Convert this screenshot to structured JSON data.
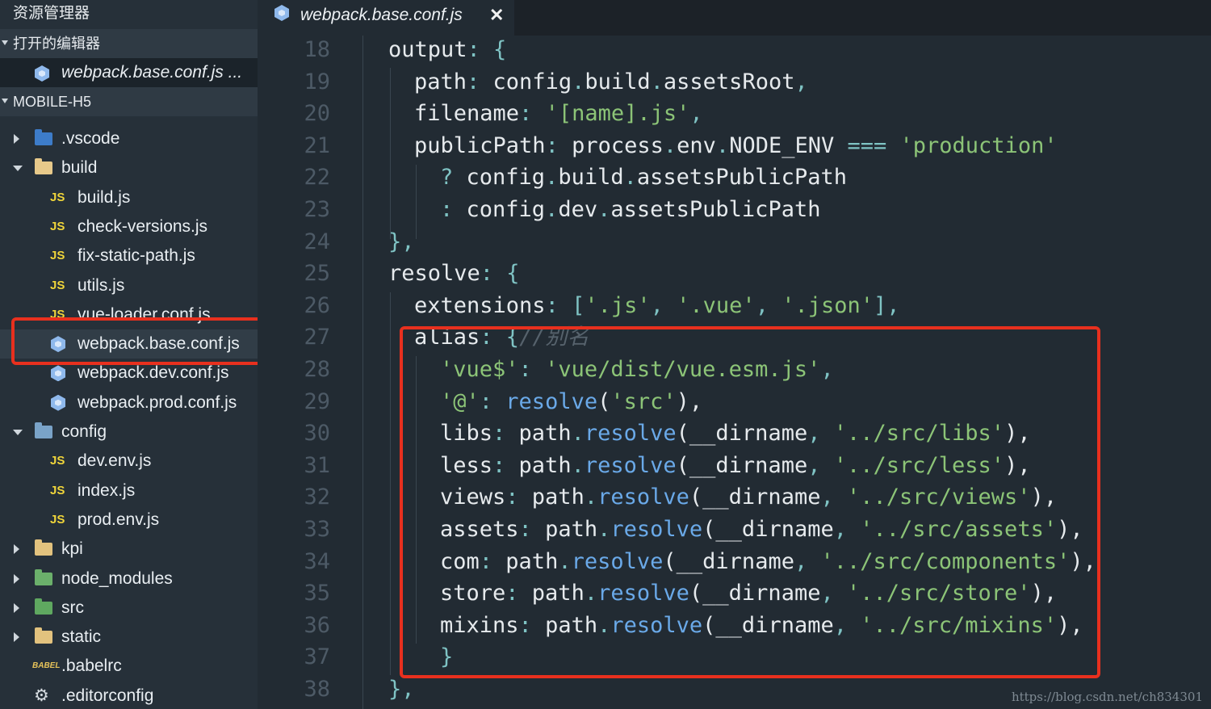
{
  "explorer": {
    "title": "资源管理器",
    "open_editors_header": "打开的编辑器",
    "open_editors": [
      {
        "name": "webpack.base.conf.js ...",
        "icon": "webpack-icon"
      }
    ],
    "project_header": "MOBILE-H5",
    "tree": [
      {
        "label": ".vscode",
        "icon": "vscode-folder-icon",
        "arrow": "collapsed",
        "depth": 0
      },
      {
        "label": "build",
        "icon": "folder-icon",
        "arrow": "expanded",
        "depth": 0
      },
      {
        "label": "build.js",
        "icon": "js-icon",
        "depth": 1
      },
      {
        "label": "check-versions.js",
        "icon": "js-icon",
        "depth": 1
      },
      {
        "label": "fix-static-path.js",
        "icon": "js-icon",
        "depth": 1
      },
      {
        "label": "utils.js",
        "icon": "js-icon",
        "depth": 1
      },
      {
        "label": "vue-loader.conf.js",
        "icon": "js-icon",
        "depth": 1
      },
      {
        "label": "webpack.base.conf.js",
        "icon": "webpack-icon",
        "depth": 1,
        "selected": true
      },
      {
        "label": "webpack.dev.conf.js",
        "icon": "webpack-icon",
        "depth": 1
      },
      {
        "label": "webpack.prod.conf.js",
        "icon": "webpack-icon",
        "depth": 1
      },
      {
        "label": "config",
        "icon": "config-folder-icon",
        "arrow": "expanded",
        "depth": 0
      },
      {
        "label": "dev.env.js",
        "icon": "js-icon",
        "depth": 1
      },
      {
        "label": "index.js",
        "icon": "js-icon",
        "depth": 1
      },
      {
        "label": "prod.env.js",
        "icon": "js-icon",
        "depth": 1
      },
      {
        "label": "kpi",
        "icon": "folder-icon",
        "arrow": "collapsed",
        "depth": 0
      },
      {
        "label": "node_modules",
        "icon": "node-folder-icon",
        "arrow": "collapsed",
        "depth": 0
      },
      {
        "label": "src",
        "icon": "src-folder-icon",
        "arrow": "collapsed",
        "depth": 0
      },
      {
        "label": "static",
        "icon": "folder-icon",
        "arrow": "collapsed",
        "depth": 0
      },
      {
        "label": ".babelrc",
        "icon": "babel-icon",
        "depth": 0
      },
      {
        "label": ".editorconfig",
        "icon": "editorconfig-icon",
        "depth": 0
      }
    ],
    "js_badge": "JS",
    "babel_badge": "BABEL"
  },
  "tab": {
    "label": "webpack.base.conf.js",
    "close": "✕"
  },
  "editor": {
    "lines": [
      {
        "num": "18",
        "indent": 0,
        "tokens": [
          [
            "output",
            "#e6eaed"
          ],
          [
            ": {",
            "#7fc3c4"
          ]
        ]
      },
      {
        "num": "19",
        "indent": 1,
        "tokens": [
          [
            "path",
            "#e6eaed"
          ],
          [
            ": ",
            "#7fc3c4"
          ],
          [
            "config",
            "#e6eaed"
          ],
          [
            ".",
            "#7fc3c4"
          ],
          [
            "build",
            "#e6eaed"
          ],
          [
            ".",
            "#7fc3c4"
          ],
          [
            "assetsRoot",
            "#e6eaed"
          ],
          [
            ",",
            "#7fc3c4"
          ]
        ]
      },
      {
        "num": "20",
        "indent": 1,
        "tokens": [
          [
            "filename",
            "#e6eaed"
          ],
          [
            ": ",
            "#7fc3c4"
          ],
          [
            "'[name].js'",
            "#8cc477"
          ],
          [
            ",",
            "#7fc3c4"
          ]
        ]
      },
      {
        "num": "21",
        "indent": 1,
        "tokens": [
          [
            "publicPath",
            "#e6eaed"
          ],
          [
            ": ",
            "#7fc3c4"
          ],
          [
            "process",
            "#e6eaed"
          ],
          [
            ".",
            "#7fc3c4"
          ],
          [
            "env",
            "#e6eaed"
          ],
          [
            ".",
            "#7fc3c4"
          ],
          [
            "NODE_ENV",
            "#e6eaed"
          ],
          [
            " === ",
            "#7fc3c4"
          ],
          [
            "'production'",
            "#8cc477"
          ]
        ]
      },
      {
        "num": "22",
        "indent": 2,
        "tokens": [
          [
            "? ",
            "#7fc3c4"
          ],
          [
            "config",
            "#e6eaed"
          ],
          [
            ".",
            "#7fc3c4"
          ],
          [
            "build",
            "#e6eaed"
          ],
          [
            ".",
            "#7fc3c4"
          ],
          [
            "assetsPublicPath",
            "#e6eaed"
          ]
        ]
      },
      {
        "num": "23",
        "indent": 2,
        "tokens": [
          [
            ": ",
            "#7fc3c4"
          ],
          [
            "config",
            "#e6eaed"
          ],
          [
            ".",
            "#7fc3c4"
          ],
          [
            "dev",
            "#e6eaed"
          ],
          [
            ".",
            "#7fc3c4"
          ],
          [
            "assetsPublicPath",
            "#e6eaed"
          ]
        ]
      },
      {
        "num": "24",
        "indent": 0,
        "tokens": [
          [
            "},",
            "#7fc3c4"
          ]
        ]
      },
      {
        "num": "25",
        "indent": 0,
        "tokens": [
          [
            "resolve",
            "#e6eaed"
          ],
          [
            ": {",
            "#7fc3c4"
          ]
        ]
      },
      {
        "num": "26",
        "indent": 1,
        "tokens": [
          [
            "extensions",
            "#e6eaed"
          ],
          [
            ": [",
            "#7fc3c4"
          ],
          [
            "'.js'",
            "#8cc477"
          ],
          [
            ", ",
            "#7fc3c4"
          ],
          [
            "'.vue'",
            "#8cc477"
          ],
          [
            ", ",
            "#7fc3c4"
          ],
          [
            "'.json'",
            "#8cc477"
          ],
          [
            "],",
            "#7fc3c4"
          ]
        ]
      },
      {
        "num": "27",
        "indent": 1,
        "tokens": [
          [
            "alias",
            "#e6eaed"
          ],
          [
            ": {",
            "#7fc3c4"
          ],
          [
            "//别名",
            "#56626c",
            "italic"
          ]
        ]
      },
      {
        "num": "28",
        "indent": 2,
        "tokens": [
          [
            "'vue$'",
            "#8cc477"
          ],
          [
            ": ",
            "#7fc3c4"
          ],
          [
            "'vue/dist/vue.esm.js'",
            "#8cc477"
          ],
          [
            ",",
            "#7fc3c4"
          ]
        ]
      },
      {
        "num": "29",
        "indent": 2,
        "tokens": [
          [
            "'@'",
            "#8cc477"
          ],
          [
            ": ",
            "#7fc3c4"
          ],
          [
            "resolve",
            "#6aa9e8"
          ],
          [
            "(",
            "#e6eaed"
          ],
          [
            "'src'",
            "#8cc477"
          ],
          [
            "),",
            "#e6eaed"
          ]
        ]
      },
      {
        "num": "30",
        "indent": 2,
        "tokens": [
          [
            "libs",
            "#e6eaed"
          ],
          [
            ": ",
            "#7fc3c4"
          ],
          [
            "path",
            "#e6eaed"
          ],
          [
            ".",
            "#7fc3c4"
          ],
          [
            "resolve",
            "#6aa9e8"
          ],
          [
            "(",
            "#e6eaed"
          ],
          [
            "__dirname",
            "#e6eaed"
          ],
          [
            ", ",
            "#7fc3c4"
          ],
          [
            "'../src/libs'",
            "#8cc477"
          ],
          [
            "),",
            "#e6eaed"
          ]
        ]
      },
      {
        "num": "31",
        "indent": 2,
        "tokens": [
          [
            "less",
            "#e6eaed"
          ],
          [
            ": ",
            "#7fc3c4"
          ],
          [
            "path",
            "#e6eaed"
          ],
          [
            ".",
            "#7fc3c4"
          ],
          [
            "resolve",
            "#6aa9e8"
          ],
          [
            "(",
            "#e6eaed"
          ],
          [
            "__dirname",
            "#e6eaed"
          ],
          [
            ", ",
            "#7fc3c4"
          ],
          [
            "'../src/less'",
            "#8cc477"
          ],
          [
            "),",
            "#e6eaed"
          ]
        ]
      },
      {
        "num": "32",
        "indent": 2,
        "tokens": [
          [
            "views",
            "#e6eaed"
          ],
          [
            ": ",
            "#7fc3c4"
          ],
          [
            "path",
            "#e6eaed"
          ],
          [
            ".",
            "#7fc3c4"
          ],
          [
            "resolve",
            "#6aa9e8"
          ],
          [
            "(",
            "#e6eaed"
          ],
          [
            "__dirname",
            "#e6eaed"
          ],
          [
            ", ",
            "#7fc3c4"
          ],
          [
            "'../src/views'",
            "#8cc477"
          ],
          [
            "),",
            "#e6eaed"
          ]
        ]
      },
      {
        "num": "33",
        "indent": 2,
        "tokens": [
          [
            "assets",
            "#e6eaed"
          ],
          [
            ": ",
            "#7fc3c4"
          ],
          [
            "path",
            "#e6eaed"
          ],
          [
            ".",
            "#7fc3c4"
          ],
          [
            "resolve",
            "#6aa9e8"
          ],
          [
            "(",
            "#e6eaed"
          ],
          [
            "__dirname",
            "#e6eaed"
          ],
          [
            ", ",
            "#7fc3c4"
          ],
          [
            "'../src/assets'",
            "#8cc477"
          ],
          [
            "),",
            "#e6eaed"
          ]
        ]
      },
      {
        "num": "34",
        "indent": 2,
        "tokens": [
          [
            "com",
            "#e6eaed"
          ],
          [
            ": ",
            "#7fc3c4"
          ],
          [
            "path",
            "#e6eaed"
          ],
          [
            ".",
            "#7fc3c4"
          ],
          [
            "resolve",
            "#6aa9e8"
          ],
          [
            "(",
            "#e6eaed"
          ],
          [
            "__dirname",
            "#e6eaed"
          ],
          [
            ", ",
            "#7fc3c4"
          ],
          [
            "'../src/components'",
            "#8cc477"
          ],
          [
            "),",
            "#e6eaed"
          ]
        ]
      },
      {
        "num": "35",
        "indent": 2,
        "tokens": [
          [
            "store",
            "#e6eaed"
          ],
          [
            ": ",
            "#7fc3c4"
          ],
          [
            "path",
            "#e6eaed"
          ],
          [
            ".",
            "#7fc3c4"
          ],
          [
            "resolve",
            "#6aa9e8"
          ],
          [
            "(",
            "#e6eaed"
          ],
          [
            "__dirname",
            "#e6eaed"
          ],
          [
            ", ",
            "#7fc3c4"
          ],
          [
            "'../src/store'",
            "#8cc477"
          ],
          [
            "),",
            "#e6eaed"
          ]
        ]
      },
      {
        "num": "36",
        "indent": 2,
        "tokens": [
          [
            "mixins",
            "#e6eaed"
          ],
          [
            ": ",
            "#7fc3c4"
          ],
          [
            "path",
            "#e6eaed"
          ],
          [
            ".",
            "#7fc3c4"
          ],
          [
            "resolve",
            "#6aa9e8"
          ],
          [
            "(",
            "#e6eaed"
          ],
          [
            "__dirname",
            "#e6eaed"
          ],
          [
            ", ",
            "#7fc3c4"
          ],
          [
            "'../src/mixins'",
            "#8cc477"
          ],
          [
            "),",
            "#e6eaed"
          ]
        ]
      },
      {
        "num": "37",
        "indent": 2,
        "tokens": [
          [
            "}",
            "#7fc3c4"
          ]
        ]
      },
      {
        "num": "38",
        "indent": 0,
        "tokens": [
          [
            "},",
            "#7fc3c4"
          ]
        ]
      }
    ]
  },
  "watermark": "https://blog.csdn.net/ch834301",
  "colors": {
    "highlight_box": "#e8301e",
    "string": "#8cc477",
    "function": "#6aa9e8",
    "punctuation": "#7fc3c4",
    "comment": "#56626c",
    "line_number": "#4d5a66",
    "js_badge": "#f0d53a"
  }
}
